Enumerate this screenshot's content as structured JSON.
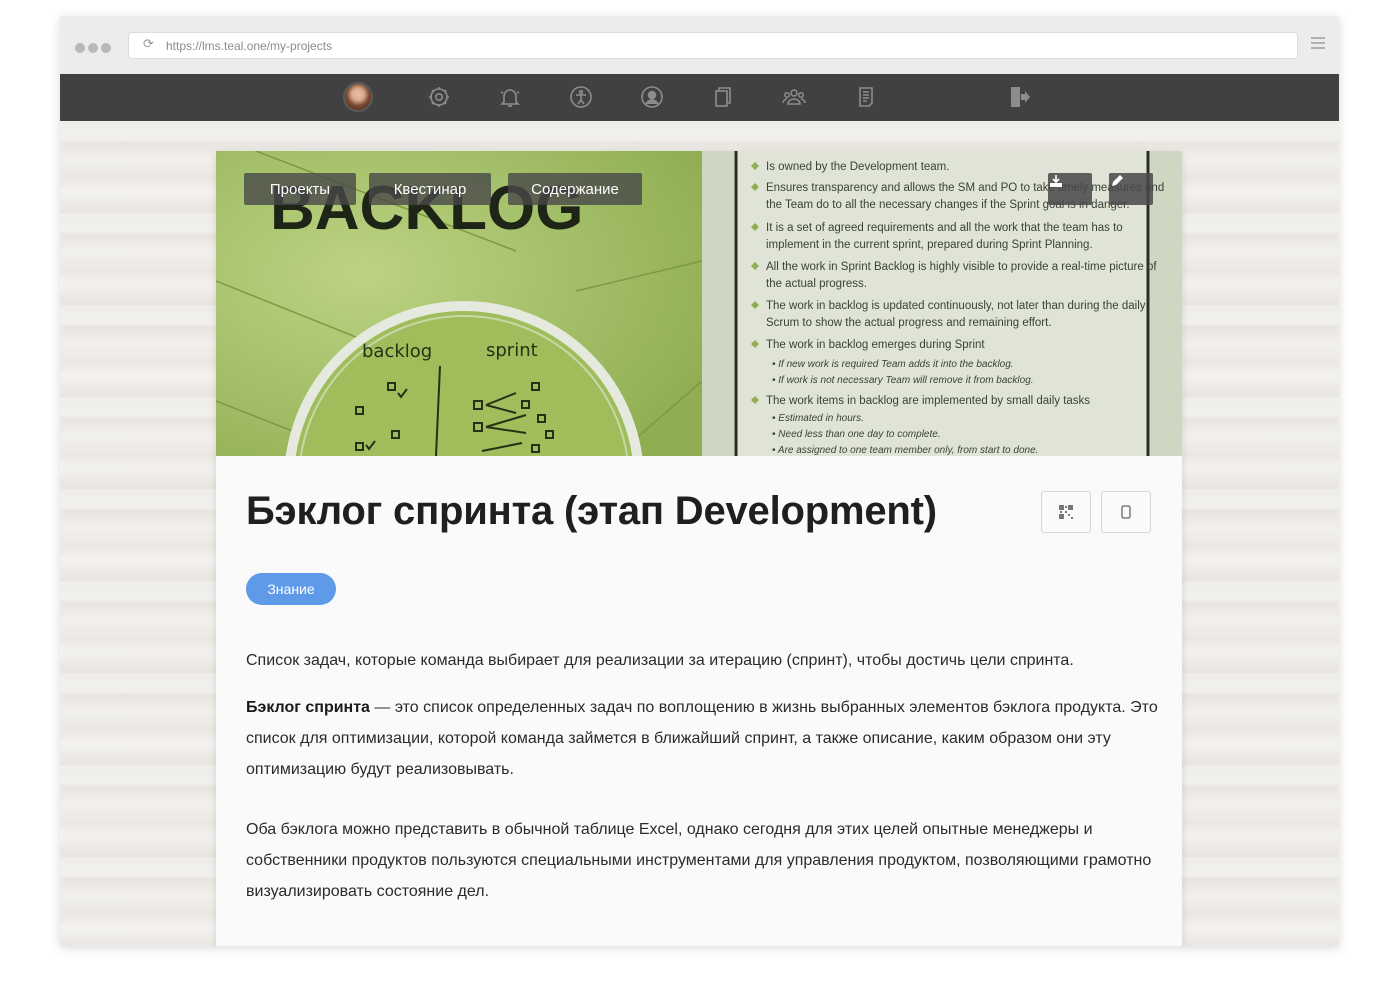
{
  "browser": {
    "url": "https://lms.teal.one/my-projects"
  },
  "nav": {
    "icons": [
      "avatar",
      "gear-icon",
      "bell-icon",
      "accessibility-icon",
      "user-circle-icon",
      "copy-icon",
      "group-icon",
      "document-icon",
      "logout-icon"
    ]
  },
  "hero": {
    "tabs": [
      "Проекты",
      "Квестинар",
      "Содержание"
    ],
    "image_text": {
      "heading": "BACKLOG",
      "circle_left": "backlog",
      "circle_right": "sprint",
      "bullets": [
        "Is owned by the Development team.",
        "Ensures transparency and allows the SM and PO to take timely measures and",
        "the Team do to all the necessary changes if the Sprint goal is in danger.",
        "It is a set of agreed requirements and all the work that the team has to",
        "implement in the current sprint, prepared during Sprint Planning.",
        "All the work in Sprint Backlog is highly visible to provide a real-time picture of",
        "the actual progress.",
        "The work in backlog is updated continuously, not later than during the daily",
        "Scrum to show the actual progress and remaining effort.",
        "The work in backlog emerges during Sprint",
        "• If new work is required Team adds it into the backlog.",
        "• If work is not necessary Team will remove it from backlog.",
        "The work items in backlog are implemented by small daily tasks",
        "• Estimated in hours.",
        "• Need less than one day to complete.",
        "• Are assigned to one team member only, from start to done."
      ]
    }
  },
  "article": {
    "title": "Бэклог спринта (этап Development)",
    "badge": "Знание",
    "p1": "Список задач, которые команда выбирает для реализации за итерацию (спринт), чтобы достичь цели спринта.",
    "p2_bold": "Бэклог спринта",
    "p2_rest": " — это список определенных задач по воплощению в жизнь выбранных элементов бэклога продукта. Это список для оптимизации, которой команда займется в ближайший спринт, а также описание, каким образом они эту оптимизацию будут реализовывать.",
    "p3": "Оба бэклога можно представить в обычной таблице Excel, однако сегодня для этих целей опытные менеджеры и собственники продуктов пользуются специальными инструментами для управления продуктом, позволяющими грамотно визуализировать состояние дел."
  },
  "colors": {
    "navbar": "#414141",
    "badge": "#5e9ae8",
    "hero_green": "#a9c46b"
  }
}
